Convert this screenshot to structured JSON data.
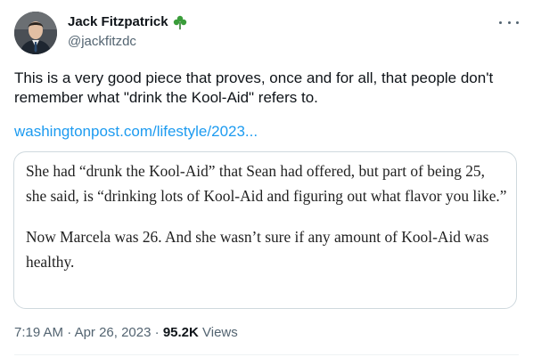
{
  "author": {
    "display_name": "Jack Fitzpatrick",
    "handle": "@jackfitzdc",
    "badge_icon": "shamrock-icon",
    "badge_color": "#3a9d3a"
  },
  "menu": {
    "more_icon": "more-horizontal-icon"
  },
  "tweet": {
    "text": "This is a very good piece that proves, once and for all, that people don't remember what \"drink the Kool-Aid\" refers to.",
    "link_text": "washingtonpost.com/lifestyle/2023...",
    "link_color": "#1d9bf0"
  },
  "quote_card": {
    "paragraph_1": "She had “drunk the Kool-Aid” that Sean had offered, but part of being 25, she said, is “drinking lots of Kool-Aid and figuring out what flavor you like.”",
    "paragraph_2": "Now Marcela was 26. And she wasn’t sure if any amount of Kool-Aid was healthy."
  },
  "meta": {
    "time": "7:19 AM",
    "separator": "·",
    "date": "Apr 26, 2023",
    "views_count": "95.2K",
    "views_label": "Views"
  }
}
